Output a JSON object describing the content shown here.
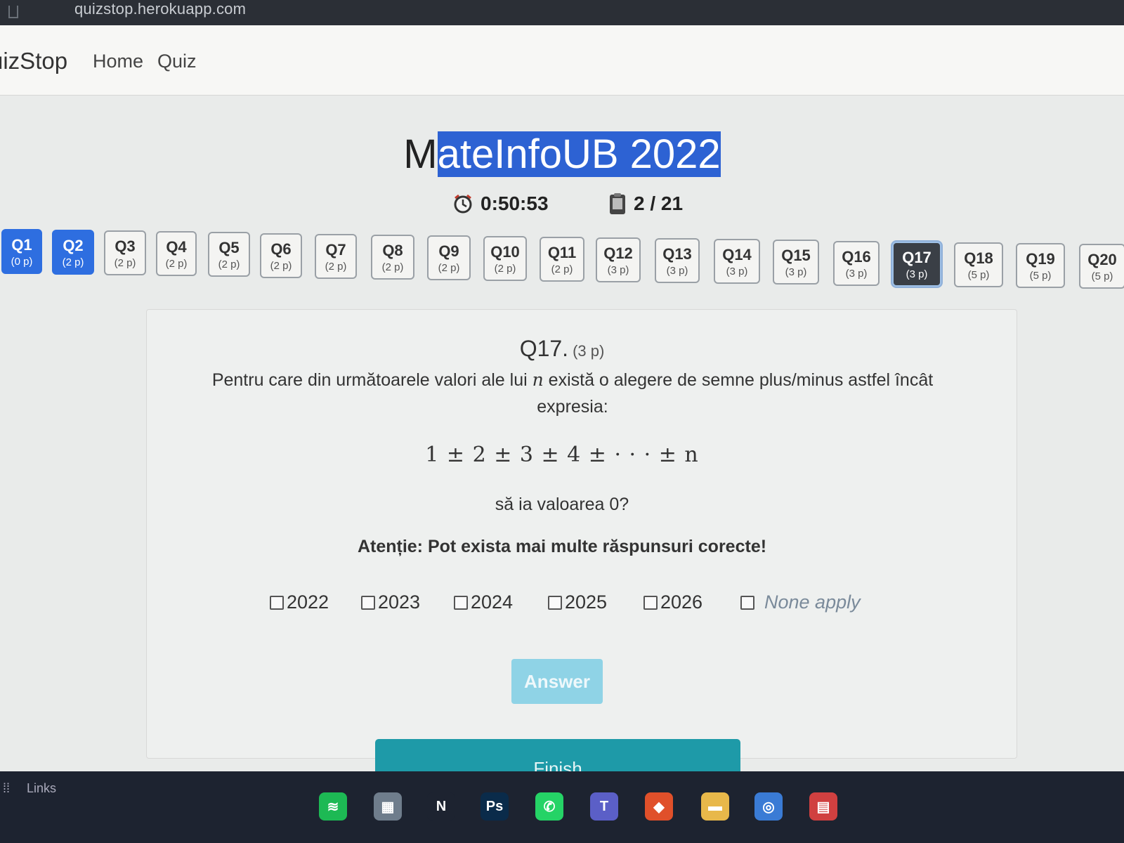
{
  "browser": {
    "url": "quizstop.herokuapp.com"
  },
  "navbar": {
    "brand": "uizStop",
    "links": [
      "Home",
      "Quiz"
    ]
  },
  "header": {
    "title_plain": "M",
    "title_selected": "ateInfoUB 2022",
    "timer": "0:50:53",
    "progress": "2 / 21"
  },
  "questions": [
    {
      "label": "Q1",
      "points": "(0 p)",
      "state": "done"
    },
    {
      "label": "Q2",
      "points": "(2 p)",
      "state": "done"
    },
    {
      "label": "Q3",
      "points": "(2 p)",
      "state": "todo"
    },
    {
      "label": "Q4",
      "points": "(2 p)",
      "state": "todo"
    },
    {
      "label": "Q5",
      "points": "(2 p)",
      "state": "todo"
    },
    {
      "label": "Q6",
      "points": "(2 p)",
      "state": "todo"
    },
    {
      "label": "Q7",
      "points": "(2 p)",
      "state": "todo"
    },
    {
      "label": "Q8",
      "points": "(2 p)",
      "state": "todo"
    },
    {
      "label": "Q9",
      "points": "(2 p)",
      "state": "todo"
    },
    {
      "label": "Q10",
      "points": "(2 p)",
      "state": "todo"
    },
    {
      "label": "Q11",
      "points": "(2 p)",
      "state": "todo"
    },
    {
      "label": "Q12",
      "points": "(3 p)",
      "state": "todo"
    },
    {
      "label": "Q13",
      "points": "(3 p)",
      "state": "todo"
    },
    {
      "label": "Q14",
      "points": "(3 p)",
      "state": "todo"
    },
    {
      "label": "Q15",
      "points": "(3 p)",
      "state": "todo"
    },
    {
      "label": "Q16",
      "points": "(3 p)",
      "state": "todo"
    },
    {
      "label": "Q17",
      "points": "(3 p)",
      "state": "active"
    },
    {
      "label": "Q18",
      "points": "(5 p)",
      "state": "todo"
    },
    {
      "label": "Q19",
      "points": "(5 p)",
      "state": "todo"
    },
    {
      "label": "Q20",
      "points": "(5 p)",
      "state": "todo"
    }
  ],
  "question": {
    "number": "Q17.",
    "points": "(3 p)",
    "text_before": "Pentru care din următoarele valori ale lui ",
    "variable": "n",
    "text_after": " există o alegere de semne plus/minus astfel încât expresia:",
    "formula": "1 ± 2 ± 3 ± 4 ± · · · ± n",
    "ask": "să ia valoarea 0?",
    "warning": "Atenție: Pot exista mai multe răspunsuri corecte!",
    "options": [
      "2022",
      "2023",
      "2024",
      "2025",
      "2026",
      "None apply"
    ]
  },
  "buttons": {
    "answer": "Answer",
    "finish": "Finish"
  },
  "taskbar": {
    "links_label": "Links",
    "apps": [
      {
        "icon": "spotify-icon",
        "glyph": "≋",
        "color": "#1db954"
      },
      {
        "icon": "store-icon",
        "glyph": "▦",
        "color": "#6f7d8c"
      },
      {
        "icon": "netflix-icon",
        "glyph": "N",
        "color": "#1d2330"
      },
      {
        "icon": "photoshop-icon",
        "glyph": "Ps",
        "color": "#0a2b4a"
      },
      {
        "icon": "whatsapp-icon",
        "glyph": "✆",
        "color": "#25d366"
      },
      {
        "icon": "teams-icon",
        "glyph": "T",
        "color": "#5b5fc7"
      },
      {
        "icon": "brave-icon",
        "glyph": "◆",
        "color": "#e0502a"
      },
      {
        "icon": "folder-icon",
        "glyph": "▬",
        "color": "#e8b84a"
      },
      {
        "icon": "chrome-icon",
        "glyph": "◎",
        "color": "#3a7bd5"
      },
      {
        "icon": "app-icon",
        "glyph": "▤",
        "color": "#d04040"
      }
    ]
  }
}
